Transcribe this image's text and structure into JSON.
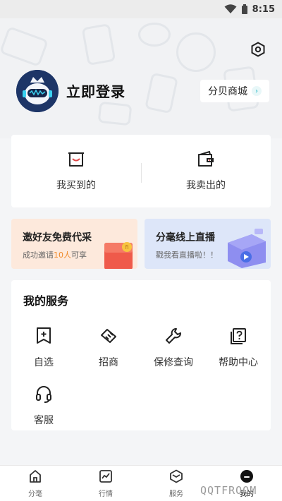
{
  "status": {
    "time": "8:15"
  },
  "profile": {
    "login_label": "立即登录",
    "mall_label": "分贝商城"
  },
  "orders": [
    {
      "label": "我买到的",
      "icon": "shopping-bag-icon"
    },
    {
      "label": "我卖出的",
      "icon": "wallet-icon"
    }
  ],
  "banners": {
    "invite": {
      "title": "邀好友免费代采",
      "sub_prefix": "成功邀请",
      "sub_highlight": "10人",
      "sub_suffix": "可享"
    },
    "live": {
      "title": "分毫线上直播",
      "sub": "戳我看直播啦！！"
    }
  },
  "services": {
    "title": "我的服务",
    "items": [
      {
        "label": "自选",
        "icon": "add-bookmark-icon"
      },
      {
        "label": "招商",
        "icon": "handshake-icon"
      },
      {
        "label": "保修查询",
        "icon": "wrench-icon"
      },
      {
        "label": "帮助中心",
        "icon": "help-icon"
      },
      {
        "label": "客服",
        "icon": "headset-icon"
      }
    ]
  },
  "tabs": [
    {
      "label": "分毫",
      "icon": "home-icon"
    },
    {
      "label": "行情",
      "icon": "chart-icon"
    },
    {
      "label": "服务",
      "icon": "box-icon"
    },
    {
      "label": "我的",
      "icon": "profile-icon"
    }
  ],
  "watermark": "QQTFROOM",
  "colors": {
    "accent_orange": "#f08a2a",
    "accent_cyan": "#1fb5c4",
    "invite_bg": "#fde9dc",
    "live_bg": "#dde6f9"
  }
}
